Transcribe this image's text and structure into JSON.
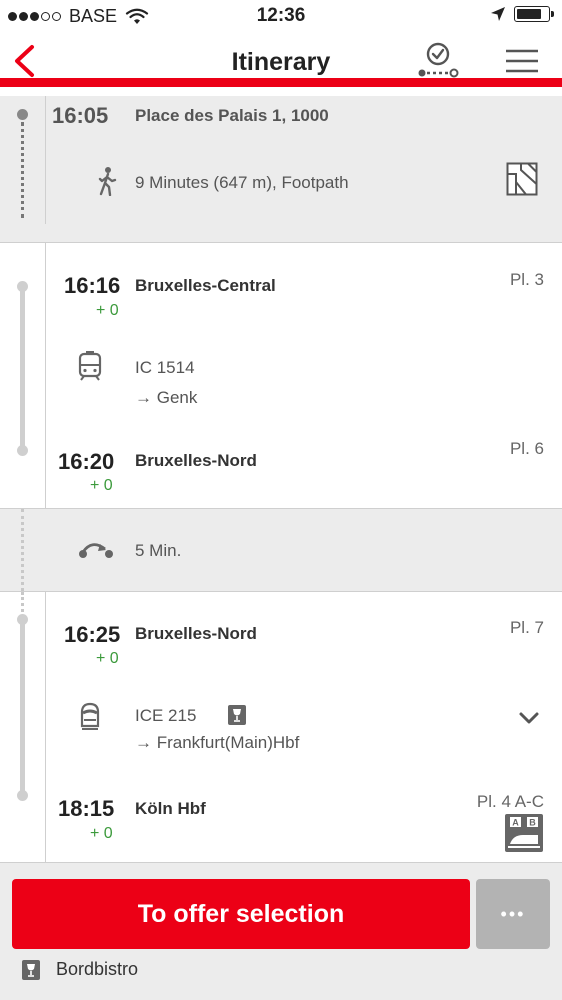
{
  "status_bar": {
    "carrier": "BASE",
    "time": "12:36",
    "battery_level": 0.8
  },
  "nav": {
    "title": "Itinerary",
    "back_icon": "chevron-left-icon",
    "clock_icon": "clock-connection-icon",
    "menu_icon": "hamburger-menu-icon"
  },
  "walk": {
    "time": "16:05",
    "address": "Place des Palais 1, 1000",
    "duration": "9 Minutes (647 m), Footpath"
  },
  "leg1": {
    "departure": {
      "time": "16:16",
      "delay": "+ 0",
      "station": "Bruxelles-Central",
      "platform": "Pl. 3"
    },
    "train": "IC 1514",
    "direction": "→ Genk",
    "arrival": {
      "time": "16:20",
      "delay": "+ 0",
      "station": "Bruxelles-Nord",
      "platform": "Pl. 6"
    }
  },
  "transfer": {
    "duration": "5 Min."
  },
  "leg2": {
    "departure": {
      "time": "16:25",
      "delay": "+ 0",
      "station": "Bruxelles-Nord",
      "platform": "Pl. 7"
    },
    "train": "ICE 215",
    "direction": "→ Frankfurt(Main)Hbf",
    "arrival": {
      "time": "18:15",
      "delay": "+ 0",
      "station": "Köln Hbf",
      "platform": "Pl. 4 A-C"
    },
    "wagon_sections": [
      "A",
      "B"
    ]
  },
  "footer": {
    "offer_label": "To offer selection",
    "more_label": "•••",
    "bistro_label": "Bordbistro"
  },
  "colors": {
    "accent": "#ec0016",
    "delay_green": "#3c9a3c",
    "section_gray": "#ececec"
  }
}
